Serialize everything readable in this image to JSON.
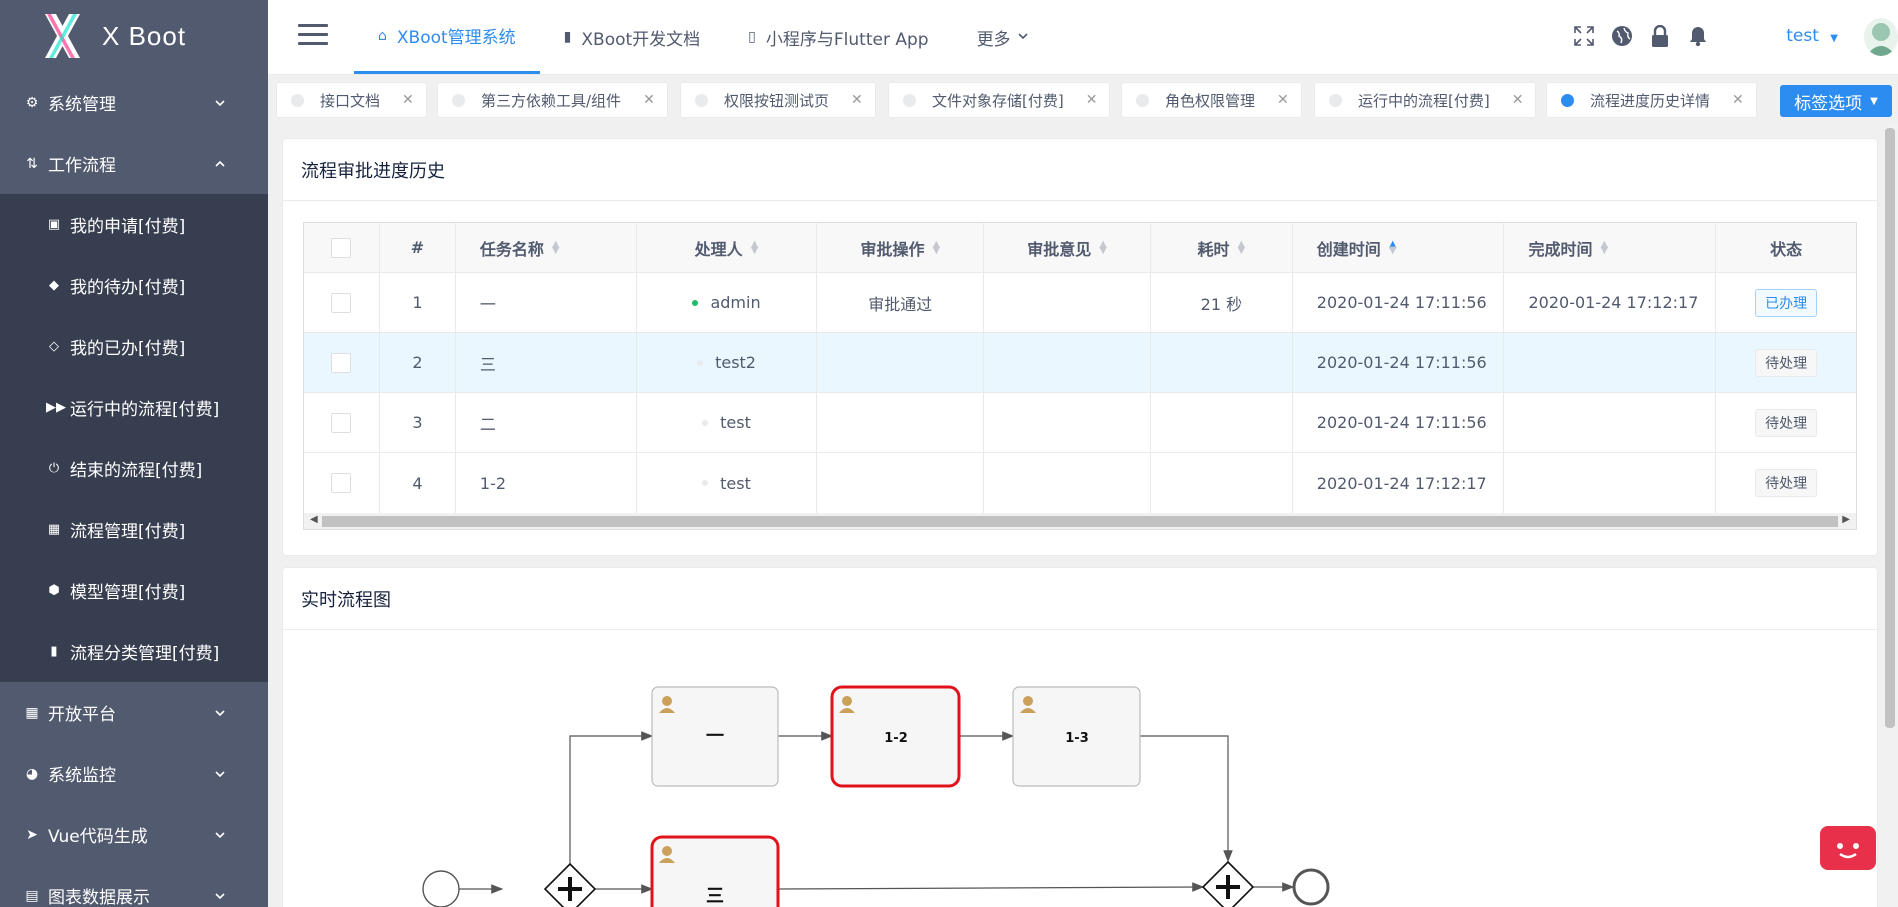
{
  "app": {
    "logo_text": "X Boot",
    "user": "test"
  },
  "sidebar": {
    "items": [
      {
        "label": "系统管理",
        "icon": "gear-icon",
        "expanded": false
      },
      {
        "label": "工作流程",
        "icon": "workflow-icon",
        "expanded": true
      },
      {
        "label": "开放平台",
        "icon": "grid-icon",
        "expanded": false
      },
      {
        "label": "系统监控",
        "icon": "monitor-icon",
        "expanded": false
      },
      {
        "label": "Vue代码生成",
        "icon": "send-icon",
        "expanded": false
      },
      {
        "label": "图表数据展示",
        "icon": "chart-icon",
        "expanded": false
      }
    ],
    "sub_items": [
      {
        "label": "我的申请[付费]",
        "icon": "clipboard-icon"
      },
      {
        "label": "我的待办[付费]",
        "icon": "tag-icon"
      },
      {
        "label": "我的已办[付费]",
        "icon": "tag-outline-icon"
      },
      {
        "label": "运行中的流程[付费]",
        "icon": "fast-forward-icon"
      },
      {
        "label": "结束的流程[付费]",
        "icon": "power-icon"
      },
      {
        "label": "流程管理[付费]",
        "icon": "calendar-icon"
      },
      {
        "label": "模型管理[付费]",
        "icon": "cube-icon"
      },
      {
        "label": "流程分类管理[付费]",
        "icon": "bookmark-icon"
      }
    ]
  },
  "header": {
    "tabs": [
      {
        "label": "XBoot管理系统",
        "icon": "home-icon",
        "active": true
      },
      {
        "label": "XBoot开发文档",
        "icon": "document-icon",
        "active": false
      },
      {
        "label": "小程序与Flutter App",
        "icon": "phone-icon",
        "active": false
      },
      {
        "label": "更多",
        "icon": "chevron-down-icon",
        "active": false
      }
    ]
  },
  "tags": {
    "items": [
      {
        "label": "接口文档",
        "active": false
      },
      {
        "label": "第三方依赖工具/组件",
        "active": false
      },
      {
        "label": "权限按钮测试页",
        "active": false
      },
      {
        "label": "文件对象存储[付费]",
        "active": false
      },
      {
        "label": "角色权限管理",
        "active": false
      },
      {
        "label": "运行中的流程[付费]",
        "active": false
      },
      {
        "label": "流程进度历史详情",
        "active": true
      }
    ],
    "options_label": "标签选项"
  },
  "history": {
    "title": "流程审批进度历史",
    "columns": [
      "#",
      "任务名称",
      "处理人",
      "审批操作",
      "审批意见",
      "耗时",
      "创建时间",
      "完成时间",
      "状态"
    ],
    "rows": [
      {
        "index": "1",
        "task": "一",
        "assignee": "admin",
        "action": "审批通过",
        "comment": "",
        "duration": "21 秒",
        "created": "2020-01-24 17:11:56",
        "finished": "2020-01-24 17:12:17",
        "status": "已办理"
      },
      {
        "index": "2",
        "task": "三",
        "assignee": "test2",
        "action": "",
        "comment": "",
        "duration": "",
        "created": "2020-01-24 17:11:56",
        "finished": "",
        "status": "待处理"
      },
      {
        "index": "3",
        "task": "二",
        "assignee": "test",
        "action": "",
        "comment": "",
        "duration": "",
        "created": "2020-01-24 17:11:56",
        "finished": "",
        "status": "待处理"
      },
      {
        "index": "4",
        "task": "1-2",
        "assignee": "test",
        "action": "",
        "comment": "",
        "duration": "",
        "created": "2020-01-24 17:12:17",
        "finished": "",
        "status": "待处理"
      }
    ]
  },
  "diagram": {
    "title": "实时流程图",
    "nodes": {
      "task1": "一",
      "task12": "1-2",
      "task13": "1-3",
      "task3": "三"
    }
  },
  "colors": {
    "accent": "#2d8cf0",
    "sidebar": "#515a6e",
    "submenu": "#363e4f",
    "active_task": "#e0131b"
  }
}
